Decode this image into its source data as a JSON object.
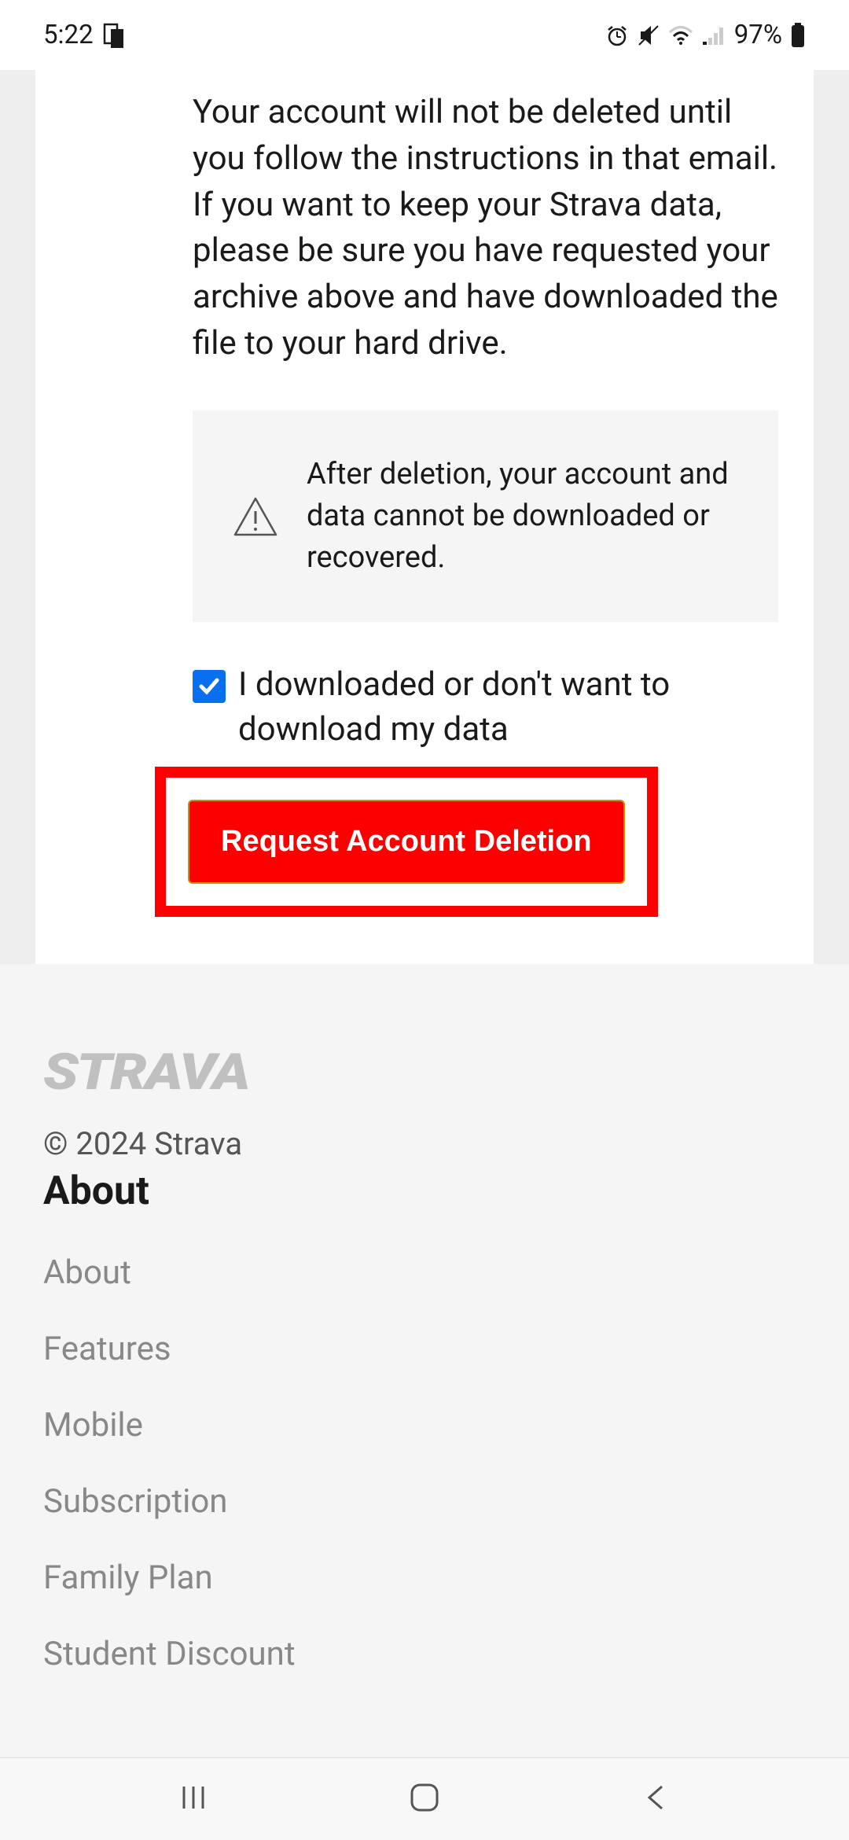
{
  "statusBar": {
    "time": "5:22",
    "batteryPercent": "97%"
  },
  "content": {
    "mainText": "Your account will not be deleted until you follow the instructions in that email. If you want to keep your Strava data, please be sure you have requested your archive above and have downloaded the file to your hard drive.",
    "warningText": "After deletion, your account and data cannot be downloaded or recovered.",
    "checkboxLabel": "I downloaded or don't want to download my data",
    "deleteButtonLabel": "Request Account Deletion",
    "checkboxChecked": true
  },
  "footer": {
    "logo": "STRAVA",
    "copyright": "© 2024 Strava",
    "aboutHeading": "About",
    "links": [
      "About",
      "Features",
      "Mobile",
      "Subscription",
      "Family Plan",
      "Student Discount"
    ]
  }
}
